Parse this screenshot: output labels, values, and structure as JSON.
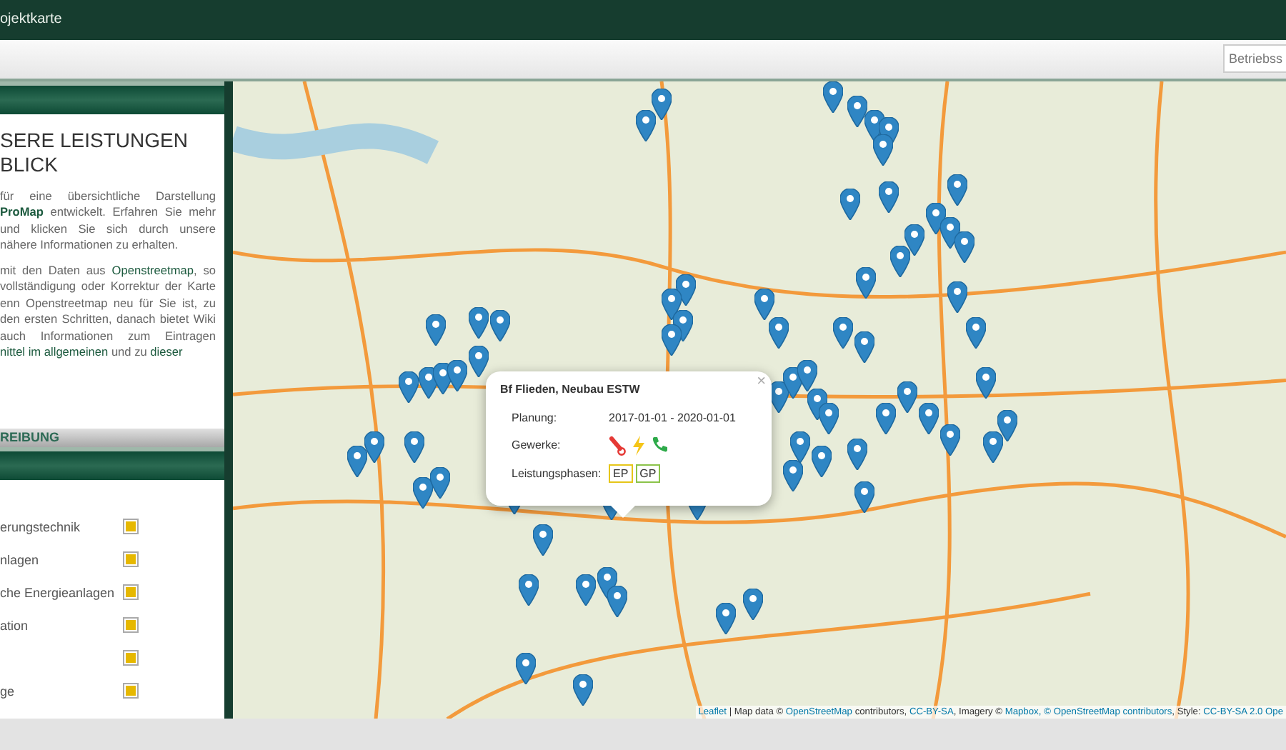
{
  "header": {
    "title": "ojektkarte"
  },
  "toolbar": {
    "search": {
      "placeholder": "Betriebss"
    }
  },
  "panel": {
    "heading_lines": [
      "SERE LEISTUNGEN",
      "BLICK"
    ],
    "paragraphs": [
      [
        {
          "kind": "text",
          "t": "für eine übersichtliche Darstellung "
        },
        {
          "kind": "bold",
          "t": "ProMap"
        },
        {
          "kind": "text",
          "t": " entwickelt. Erfahren Sie mehr und klicken Sie sich durch unsere nähere Informationen zu erhalten."
        }
      ],
      [
        {
          "kind": "text",
          "t": "mit den Daten aus "
        },
        {
          "kind": "link",
          "t": "Openstreetmap"
        },
        {
          "kind": "text",
          "t": ", so vollständigung oder Korrektur der Karte enn Openstreetmap neu für Sie ist, zu den ersten Schritten, danach bietet Wiki auch Informationen zum Eintragen "
        },
        {
          "kind": "link",
          "t": "nittel im allgemeinen"
        },
        {
          "kind": "text",
          "t": " und zu "
        },
        {
          "kind": "link",
          "t": "dieser"
        }
      ]
    ],
    "section_title": "REIBUNG",
    "legend": [
      {
        "label": "erungstechnik",
        "checked": true
      },
      {
        "label": "nlagen",
        "checked": true
      },
      {
        "label": "che Energieanlagen",
        "checked": true
      },
      {
        "label": "ation",
        "checked": true
      },
      {
        "checked": true
      },
      {
        "label": "ge",
        "checked": true
      }
    ]
  },
  "popup": {
    "title": "Bf Flieden, Neubau ESTW",
    "close": "×",
    "rows": [
      {
        "label": "Planung:",
        "kind": "text",
        "value": "2017-01-01 - 2020-01-01"
      },
      {
        "label": "Gewerke:",
        "kind": "icons"
      },
      {
        "label": "Leistungsphasen:",
        "kind": "badges",
        "badges": [
          {
            "text": "EP",
            "color": "#e6c619"
          },
          {
            "text": "GP",
            "color": "#8bc34a"
          }
        ]
      }
    ]
  },
  "attribution": [
    {
      "kind": "link",
      "t": "Leaflet"
    },
    {
      "kind": "text",
      "t": " | Map data © "
    },
    {
      "kind": "link",
      "t": "OpenStreetMap"
    },
    {
      "kind": "text",
      "t": " contributors, "
    },
    {
      "kind": "link",
      "t": "CC-BY-SA"
    },
    {
      "kind": "text",
      "t": ", Imagery © "
    },
    {
      "kind": "link",
      "t": "Mapbox,"
    },
    {
      "kind": "link",
      "t": "© OpenStreetMap contributors"
    },
    {
      "kind": "text",
      "t": ", Style: "
    },
    {
      "kind": "link",
      "t": "CC-BY-SA 2.0 Ope"
    }
  ]
}
